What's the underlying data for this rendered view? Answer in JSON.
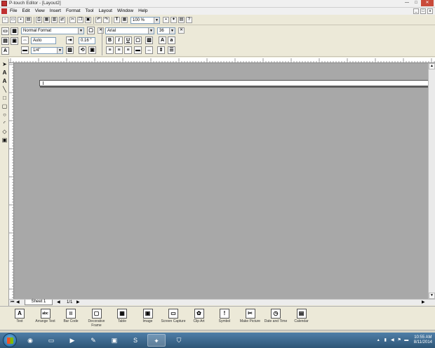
{
  "window": {
    "title": "P-touch Editor - [Layout2]"
  },
  "menu": [
    "File",
    "Edit",
    "View",
    "Insert",
    "Format",
    "Tool",
    "Layout",
    "Window",
    "Help"
  ],
  "toolbar": {
    "zoom": "100 %",
    "text_glyph": "T"
  },
  "format_panel": {
    "format": "Normal Format",
    "length": "Auto",
    "margin": "0.16 \"",
    "tape_width": "1/4\""
  },
  "font_panel": {
    "font": "Arial",
    "size": "36",
    "bold": "B",
    "italic": "I",
    "underline": "U"
  },
  "sheet": {
    "tab": "Sheet 1",
    "page": "1/1"
  },
  "dock": [
    {
      "label": "Text",
      "icon": "text-icon",
      "glyph": "A"
    },
    {
      "label": "Arrange Text",
      "icon": "arrange-text-icon",
      "glyph": "abc"
    },
    {
      "label": "Bar Code",
      "icon": "barcode-icon",
      "glyph": "|||"
    },
    {
      "label": "Decorative Frame",
      "icon": "frame-icon",
      "glyph": "▢"
    },
    {
      "label": "Table",
      "icon": "table-icon",
      "glyph": "▦"
    },
    {
      "label": "Image",
      "icon": "image-icon",
      "glyph": "▣"
    },
    {
      "label": "Screen Capture",
      "icon": "screen-capture-icon",
      "glyph": "▭"
    },
    {
      "label": "Clip Art",
      "icon": "clip-art-icon",
      "glyph": "✿"
    },
    {
      "label": "Symbol",
      "icon": "symbol-icon",
      "glyph": "!"
    },
    {
      "label": "Make Picture",
      "icon": "make-picture-icon",
      "glyph": "✂"
    },
    {
      "label": "Date and Time",
      "icon": "date-time-icon",
      "glyph": "◷"
    },
    {
      "label": "Calendar",
      "icon": "calendar-icon",
      "glyph": "▤"
    }
  ],
  "taskbar": {
    "time": "10:55 AM",
    "date": "8/11/2014"
  },
  "colors": {
    "canvas": "#a8a8a8",
    "taskbar": "#3a6689",
    "panel": "#ece9d8"
  }
}
